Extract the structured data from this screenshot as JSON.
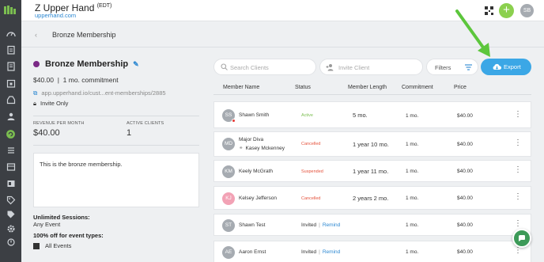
{
  "app": {
    "title": "Z Upper Hand",
    "title_suffix": "(EDT)",
    "subtitle": "upperhand.com",
    "avatar_initials": "SB"
  },
  "breadcrumb": {
    "title": "Bronze Membership"
  },
  "membership": {
    "name": "Bronze Membership",
    "price_line": "$40.00  |  1 mo. commitment",
    "url": "app.upperhand.io/cust...ent-memberships/2885",
    "invite": "Invite Only",
    "stats": {
      "revenue_label": "REVENUE PER MONTH",
      "revenue_value": "$40.00",
      "clients_label": "ACTIVE CLIENTS",
      "clients_value": "1"
    },
    "description": "This is the bronze membership.",
    "unlimited_title": "Unlimited Sessions:",
    "unlimited_value": "Any Event",
    "discount_title": "100% off for event types:",
    "discount_value": "All Events"
  },
  "toolbar": {
    "search_placeholder": "Search Clients",
    "invite_placeholder": "Invite Client",
    "filters_label": "Filters",
    "export_label": "Export"
  },
  "table": {
    "headers": {
      "member": "Member Name",
      "status": "Status",
      "length": "Member Length",
      "commitment": "Commitment",
      "price": "Price"
    },
    "rows": [
      {
        "initials": "SS",
        "name": "Shawn Smith",
        "sub": "",
        "status": "Active",
        "status_kind": "active",
        "remind": "",
        "length": "5 mo.",
        "commitment": "1 mo.",
        "price": "$40.00"
      },
      {
        "initials": "MD",
        "name": "Major Diva",
        "sub": "Kasey Mckenney",
        "status": "Cancelled",
        "status_kind": "cancelled",
        "remind": "",
        "length": "1 year 10 mo.",
        "commitment": "1 mo.",
        "price": "$40.00"
      },
      {
        "initials": "KM",
        "name": "Keely McGrath",
        "sub": "",
        "status": "Suspended",
        "status_kind": "suspended",
        "remind": "",
        "length": "1 year 11 mo.",
        "commitment": "1 mo.",
        "price": "$40.00"
      },
      {
        "initials": "KJ",
        "name": "Kelsey Jefferson",
        "sub": "",
        "status": "Cancelled",
        "status_kind": "cancelled",
        "remind": "",
        "length": "2 years 2 mo.",
        "commitment": "1 mo.",
        "price": "$40.00"
      },
      {
        "initials": "ST",
        "name": "Shawn Test",
        "sub": "",
        "status": "Invited",
        "status_kind": "invited",
        "remind": "Remind",
        "length": "",
        "commitment": "1 mo.",
        "price": "$40.00"
      },
      {
        "initials": "AE",
        "name": "Aaron Ernst",
        "sub": "",
        "status": "Invited",
        "status_kind": "invited",
        "remind": "Remind",
        "length": "",
        "commitment": "1 mo.",
        "price": "$40.00"
      }
    ]
  },
  "colors": {
    "rail": "#3c3f44",
    "accent": "#3ba7e6",
    "brand_green": "#8bd04e",
    "membership_dot": "#7b2a86",
    "active": "#7bbe50",
    "cancelled": "#e5533d"
  },
  "icons": {
    "rail": [
      "dashboard-icon",
      "clipboard-icon",
      "document-icon",
      "calendar-icon",
      "inbox-icon",
      "contacts-icon",
      "membership-icon",
      "list-icon",
      "cart-icon",
      "reports-icon",
      "id-card-icon",
      "tag-icon",
      "ticket-icon",
      "settings-icon",
      "marketing-icon"
    ]
  }
}
